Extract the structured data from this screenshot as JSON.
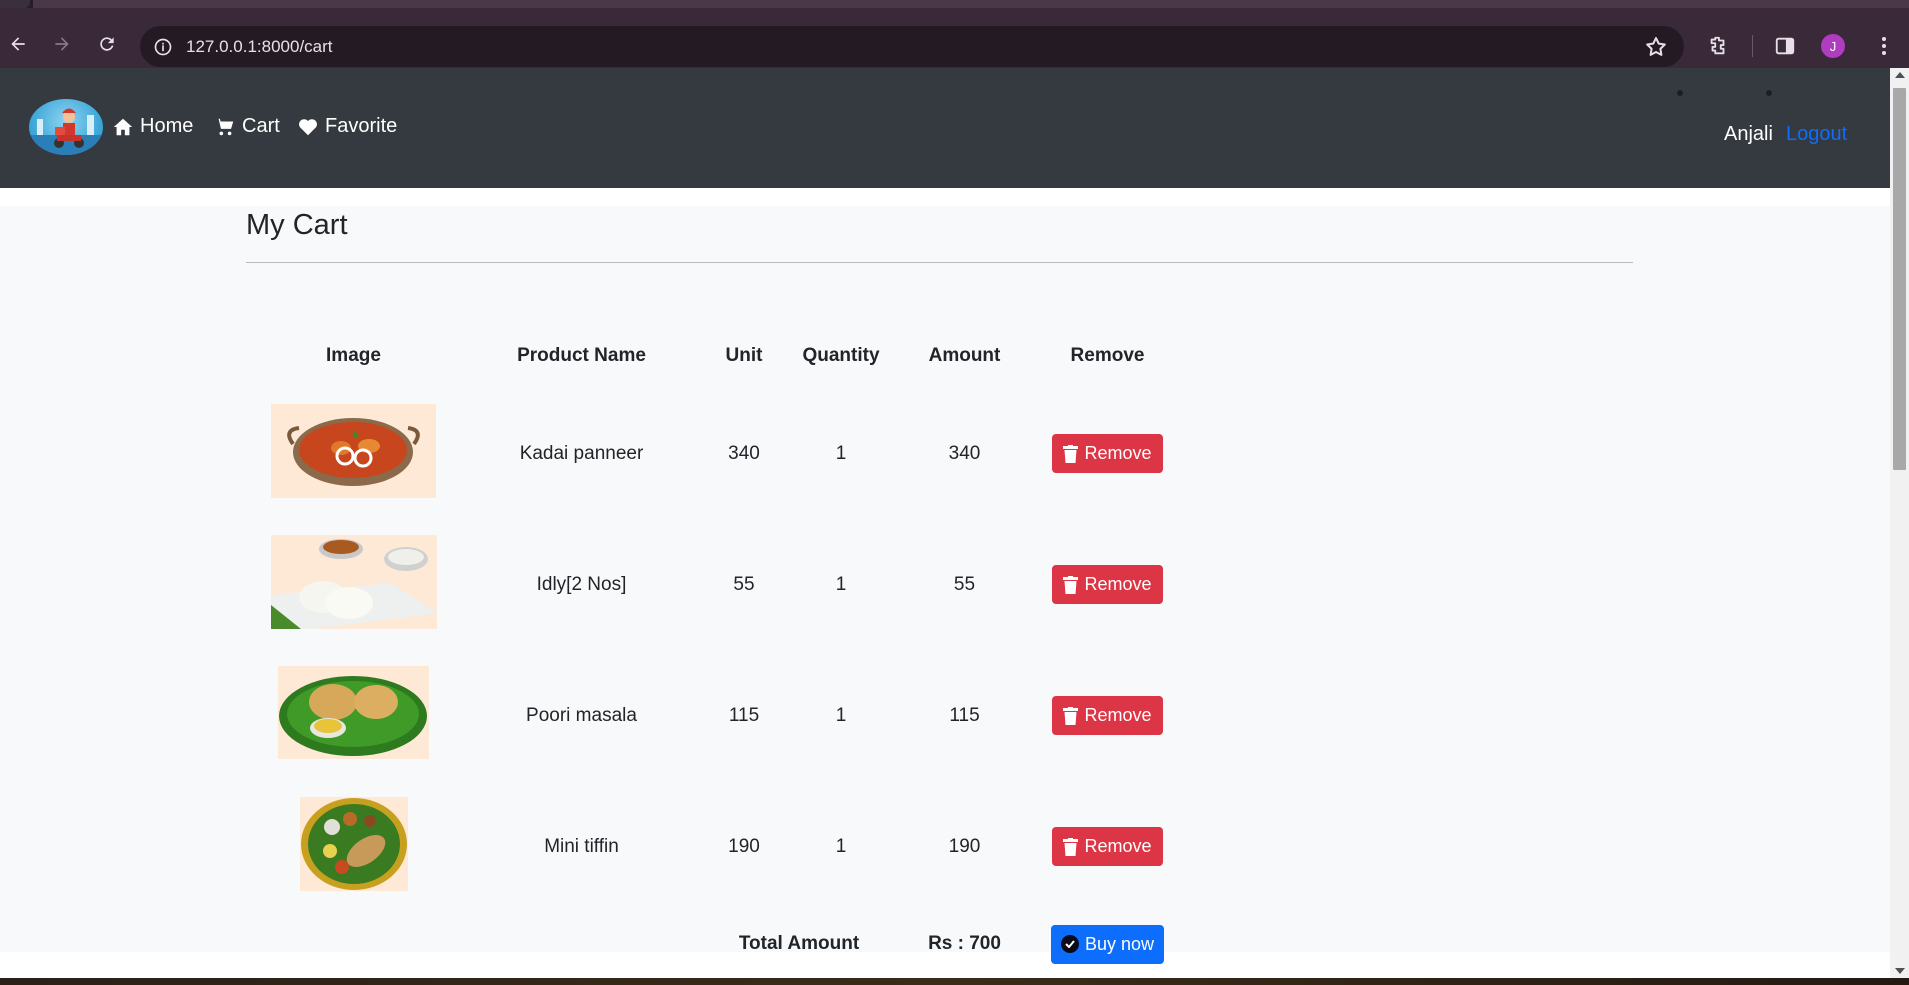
{
  "browser": {
    "url": "127.0.0.1:8000/cart",
    "profile_initial": "J"
  },
  "navbar": {
    "home_label": "Home",
    "cart_label": "Cart",
    "favorite_label": "Favorite",
    "user_name": "Anjali",
    "logout_label": "Logout"
  },
  "page": {
    "title": "My Cart"
  },
  "table": {
    "headers": {
      "image": "Image",
      "product_name": "Product Name",
      "unit": "Unit",
      "quantity": "Quantity",
      "amount": "Amount",
      "remove": "Remove"
    },
    "rows": [
      {
        "name": "Kadai panneer",
        "unit": "340",
        "quantity": "1",
        "amount": "340",
        "remove_label": "Remove"
      },
      {
        "name": "Idly[2 Nos]",
        "unit": "55",
        "quantity": "1",
        "amount": "55",
        "remove_label": "Remove"
      },
      {
        "name": "Poori masala",
        "unit": "115",
        "quantity": "1",
        "amount": "115",
        "remove_label": "Remove"
      },
      {
        "name": "Mini tiffin",
        "unit": "190",
        "quantity": "1",
        "amount": "190",
        "remove_label": "Remove"
      }
    ],
    "total_label": "Total Amount",
    "total_value": "Rs : 700",
    "buy_label": "Buy now"
  },
  "colors": {
    "navbar_bg": "#343a40",
    "remove_button": "#dc3545",
    "buy_button": "#0d6efd",
    "link": "#0d6efd"
  }
}
